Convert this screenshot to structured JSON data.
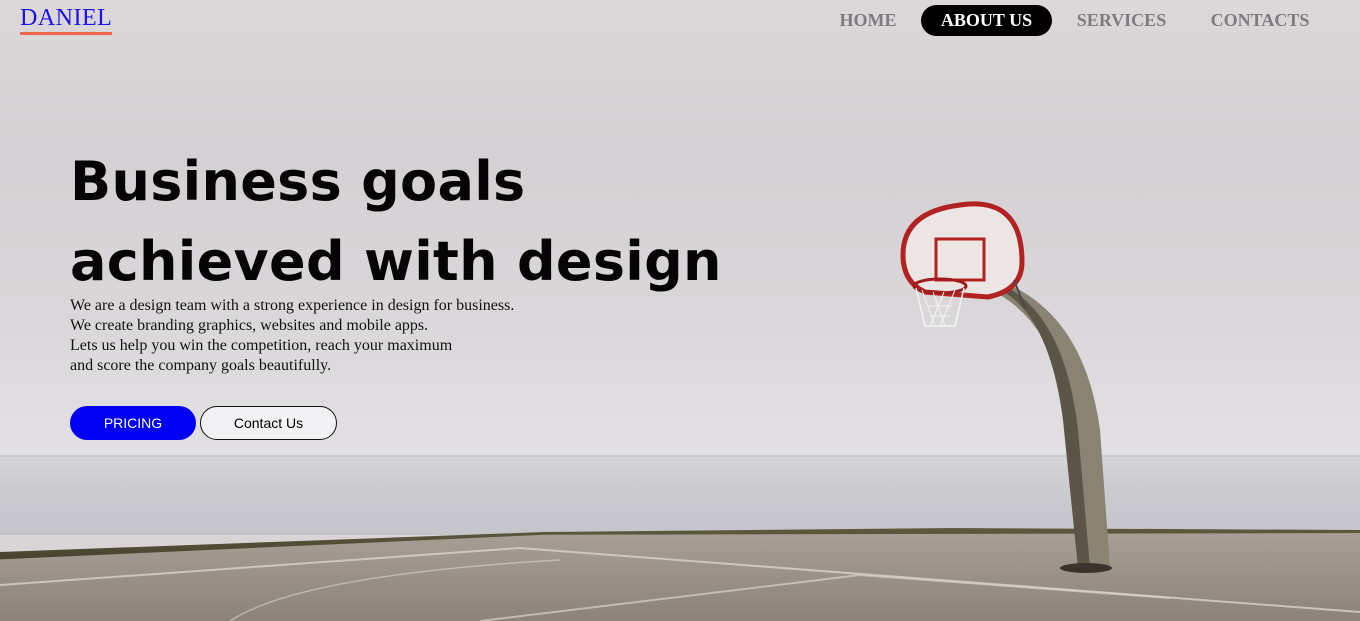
{
  "header": {
    "logo": "DANIEL",
    "nav": [
      {
        "label": "HOME",
        "active": false
      },
      {
        "label": "ABOUT US",
        "active": true
      },
      {
        "label": "SERVICES",
        "active": false
      },
      {
        "label": "CONTACTS",
        "active": false
      }
    ]
  },
  "hero": {
    "title_lines": [
      "Business goals",
      "achieved with design"
    ],
    "text_lines": [
      "We are a design team with a strong experience in design for business.",
      "We create branding graphics, websites and mobile apps.",
      "Lets us help you win the competition, reach your maximum",
      "and score the company goals beautifully."
    ],
    "primary_button": "PRICING",
    "secondary_button": "Contact Us"
  },
  "colors": {
    "logo": "#1a12e6",
    "logo_underline": "#f0664f",
    "primary_button": "#0000f5",
    "nav_active_bg": "#000000",
    "nav_text": "#7d7b80"
  },
  "background_image": "basketball-hoop-by-sea"
}
